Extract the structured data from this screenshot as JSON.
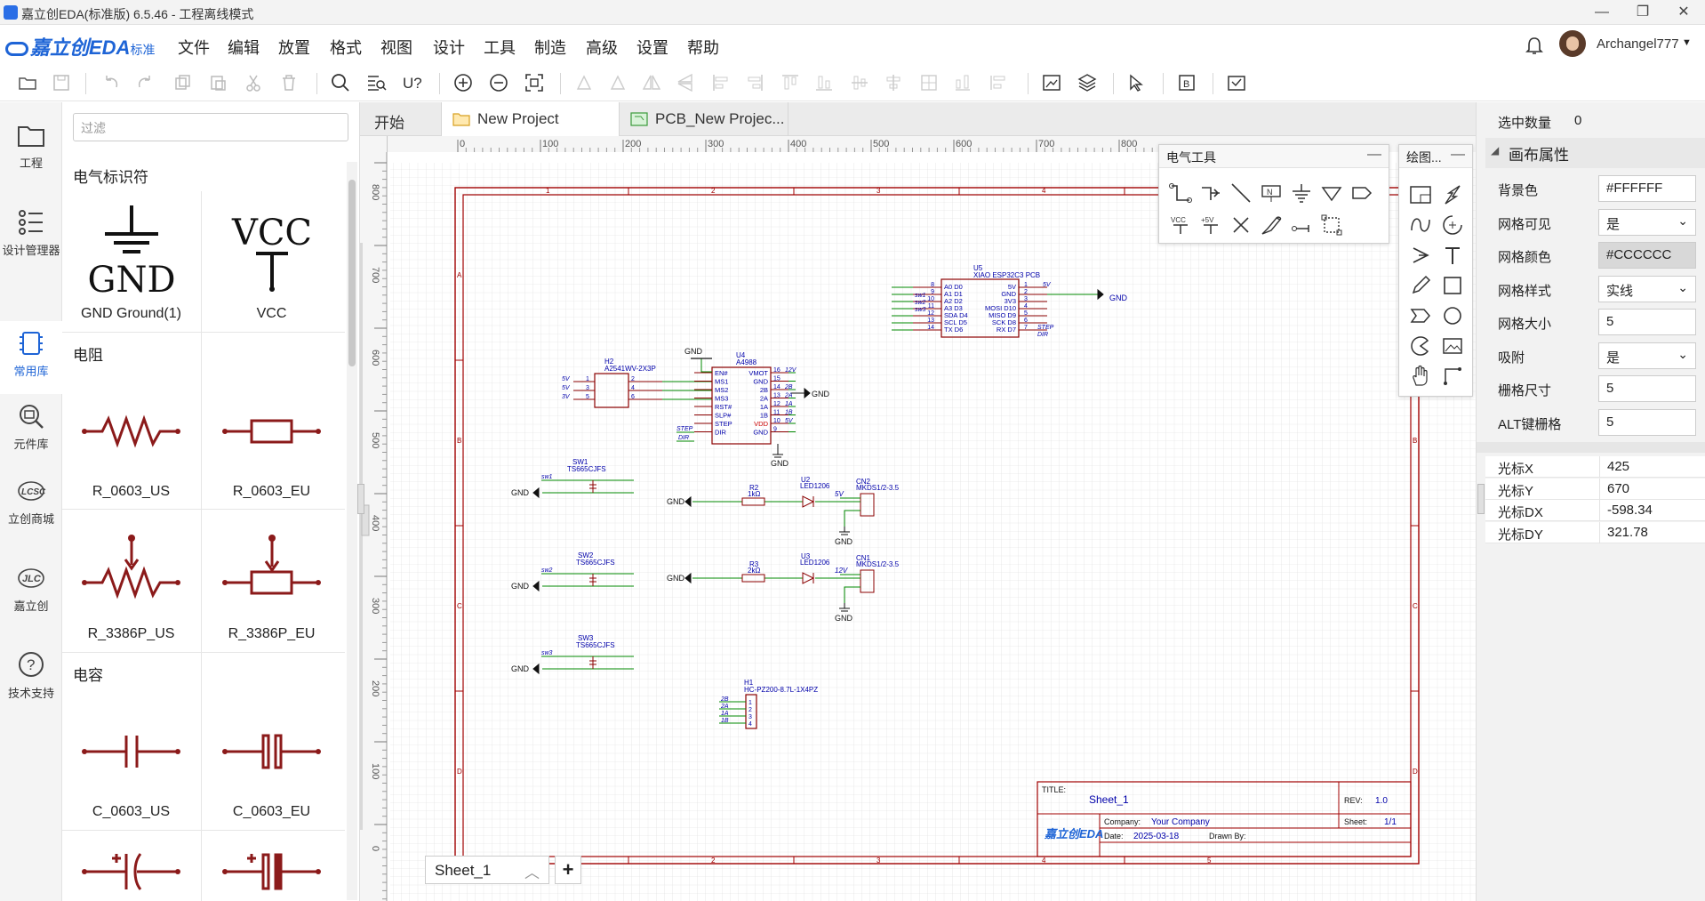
{
  "window": {
    "title": "嘉立创EDA(标准版) 6.5.46 - 工程离线模式",
    "controls": [
      "—",
      "❐",
      "✕"
    ]
  },
  "menubar": {
    "logo": "嘉立创EDA",
    "edition": "标准",
    "items": [
      "文件",
      "编辑",
      "放置",
      "格式",
      "视图",
      "设计",
      "工具",
      "制造",
      "高级",
      "设置",
      "帮助"
    ],
    "user": "Archangel777"
  },
  "rail": {
    "items": [
      {
        "label": "工程",
        "icon": "folder-icon"
      },
      {
        "label": "设计管理器",
        "icon": "design-manager-icon"
      },
      {
        "label": "常用库",
        "icon": "common-library-icon"
      },
      {
        "label": "元件库",
        "icon": "component-library-icon"
      },
      {
        "label": "立创商城",
        "icon": "lcsc-icon"
      },
      {
        "label": "嘉立创",
        "icon": "jlc-icon"
      },
      {
        "label": "技术支持",
        "icon": "help-icon"
      }
    ]
  },
  "library": {
    "filter_placeholder": "过滤",
    "sections": [
      "电气标识符",
      "电阻",
      "电容"
    ],
    "items": [
      "GND Ground(1)",
      "VCC",
      "R_0603_US",
      "R_0603_EU",
      "R_3386P_US",
      "R_3386P_EU",
      "C_0603_US",
      "C_0603_EU"
    ],
    "symbol_text": {
      "gnd": "GND",
      "vcc": "VCC"
    }
  },
  "tabs": [
    "开始",
    "New Project",
    "PCB_New Projec..."
  ],
  "ruler": {
    "top": [
      "0",
      "100",
      "200",
      "300",
      "400",
      "500",
      "600",
      "700",
      "800"
    ],
    "left": [
      "800",
      "700",
      "600",
      "500",
      "400",
      "300",
      "200",
      "100",
      "0"
    ]
  },
  "schematic": {
    "border_cols": [
      "1",
      "2",
      "3",
      "4",
      "5"
    ],
    "border_rows": [
      "A",
      "B",
      "C",
      "D"
    ],
    "u5": {
      "ref": "U5",
      "name": "XIAO ESP32C3 PCB",
      "left_pins": [
        "8",
        "9",
        "10",
        "11",
        "12",
        "13",
        "14"
      ],
      "left_names": [
        "A0 D0",
        "A1 D1",
        "A2 D2",
        "A3 D3",
        "SDA D4",
        "SCL D5",
        "TX D6"
      ],
      "right_pins": [
        "1",
        "2",
        "3",
        "4",
        "5",
        "6",
        "7"
      ],
      "right_names": [
        "5V",
        "GND",
        "3V3",
        "MOSI D10",
        "MISO D9",
        "SCK D8",
        "RX D7"
      ],
      "nets": [
        "sw1",
        "sw2",
        "sw3"
      ],
      "right_nets": [
        "5V",
        "STEP",
        "DIR"
      ],
      "gnd": "GND"
    },
    "h2": {
      "ref": "H2",
      "name": "A2541WV-2X3P",
      "left_pins": [
        "1",
        "3",
        "5"
      ],
      "right_pins": [
        "2",
        "4",
        "6"
      ],
      "nets": [
        "5V",
        "5V",
        "3V"
      ]
    },
    "u4": {
      "ref": "U4",
      "name": "A4988",
      "left_names": [
        "EN#",
        "MS1",
        "MS2",
        "MS3",
        "RST#",
        "SLP#",
        "STEP",
        "DIR"
      ],
      "right_names": [
        "VMOT",
        "GND",
        "2B",
        "2A",
        "1A",
        "1B",
        "VDD",
        "GND"
      ],
      "right_pins": [
        "16",
        "15",
        "14",
        "13",
        "12",
        "11",
        "10",
        "9"
      ],
      "right_nets": [
        "12V",
        "",
        "2B",
        "2A",
        "1A",
        "1B",
        "5V",
        ""
      ],
      "left_nets": [
        "STEP",
        "DIR"
      ],
      "gnd": "GND"
    },
    "switches": [
      {
        "ref": "SW1",
        "name": "TS665CJFS",
        "net": "sw1"
      },
      {
        "ref": "SW2",
        "name": "TS665CJFS",
        "net": "sw2"
      },
      {
        "ref": "SW3",
        "name": "TS665CJFS",
        "net": "sw3"
      }
    ],
    "leds": [
      {
        "ref": "R2",
        "val": "1kΩ",
        "led": "U2",
        "ledname": "LED1206",
        "conn": "CN2",
        "connname": "MKDS1/2-3.5",
        "net": "5V"
      },
      {
        "ref": "R3",
        "val": "2kΩ",
        "led": "U3",
        "ledname": "LED1206",
        "conn": "CN1",
        "connname": "MKDS1/2-3.5",
        "net": "12V"
      }
    ],
    "h1": {
      "ref": "H1",
      "name": "HC-PZ200-8.7L-1X4PZ",
      "nets": [
        "2B",
        "2A",
        "1A",
        "1B"
      ],
      "pins": [
        "1",
        "2",
        "3",
        "4"
      ]
    },
    "gnd_label": "GND",
    "title_block": {
      "title_label": "TITLE:",
      "title": "Sheet_1",
      "rev_label": "REV:",
      "rev": "1.0",
      "company_label": "Company:",
      "company": "Your Company",
      "sheet_label": "Sheet:",
      "sheet": "1/1",
      "date_label": "Date:",
      "date": "2025-03-18",
      "drawn_label": "Drawn By:",
      "logo": "嘉立创EDA"
    }
  },
  "sheet_tab": {
    "label": "Sheet_1",
    "add": "+"
  },
  "electric_tools": {
    "title": "电气工具",
    "min": "—",
    "vcc_text": "VCC",
    "plus5v_text": "+5V"
  },
  "drawing_tools": {
    "title": "绘图...",
    "min": "—"
  },
  "right_panel": {
    "selected_label": "选中数量",
    "selected_count": "0",
    "section": "画布属性",
    "props": [
      {
        "label": "背景色",
        "value": "#FFFFFF",
        "type": "text"
      },
      {
        "label": "网格可见",
        "value": "是",
        "type": "select"
      },
      {
        "label": "网格颜色",
        "value": "#CCCCCC",
        "type": "grey"
      },
      {
        "label": "网格样式",
        "value": "实线",
        "type": "select"
      },
      {
        "label": "网格大小",
        "value": "5",
        "type": "text"
      },
      {
        "label": "吸附",
        "value": "是",
        "type": "select"
      },
      {
        "label": "栅格尺寸",
        "value": "5",
        "type": "text"
      },
      {
        "label": "ALT键栅格",
        "value": "5",
        "type": "text"
      }
    ],
    "cursor": [
      {
        "label": "光标X",
        "value": "425"
      },
      {
        "label": "光标Y",
        "value": "670"
      },
      {
        "label": "光标DX",
        "value": "-598.34"
      },
      {
        "label": "光标DY",
        "value": "321.78"
      }
    ]
  },
  "colors": {
    "accent": "#1e64d6",
    "wire": "#008800",
    "symbol": "#8b0000",
    "text": "#0000aa",
    "frame": "#a00000",
    "grid": "#cccccc"
  }
}
